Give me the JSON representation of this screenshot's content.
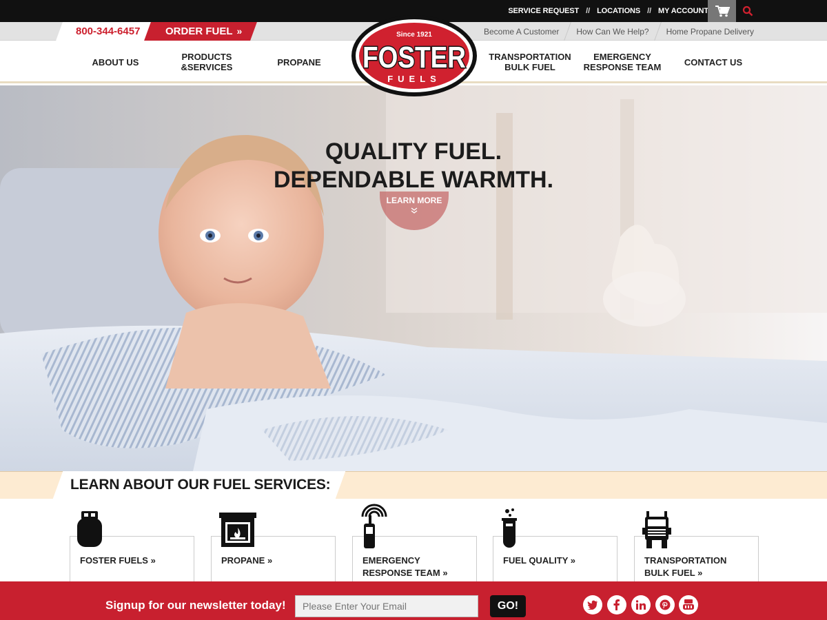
{
  "utility": {
    "links": [
      "SERVICE REQUEST",
      "LOCATIONS",
      "MY ACCOUNT"
    ],
    "separator": "//",
    "cart_icon": "cart-icon",
    "search_icon": "search-icon"
  },
  "secondary": {
    "phone": "800-344-6457",
    "order_fuel": "ORDER FUEL",
    "links": [
      "Become A Customer",
      "How Can We Help?",
      "Home Propane Delivery"
    ]
  },
  "logo": {
    "since": "Since 1921",
    "name": "FOSTER",
    "sub": "FUELS"
  },
  "nav": {
    "about": "ABOUT US",
    "products_1": "PRODUCTS",
    "products_2": "&SERVICES",
    "propane": "PROPANE",
    "transport_1": "TRANSPORTATION",
    "transport_2": "BULK FUEL",
    "emergency_1": "EMERGENCY",
    "emergency_2": "RESPONSE TEAM",
    "contact": "CONTACT US"
  },
  "hero": {
    "line1": "QUALITY FUEL.",
    "line2": "DEPENDABLE WARMTH.",
    "cta": "LEARN MORE"
  },
  "services": {
    "heading": "LEARN ABOUT OUR FUEL SERVICES:",
    "cards": [
      {
        "line1": "FOSTER FUELS",
        "line2": "",
        "icon": "propane-tank-icon"
      },
      {
        "line1": "PROPANE",
        "line2": "",
        "icon": "fireplace-icon"
      },
      {
        "line1": "EMERGENCY",
        "line2": "RESPONSE TEAM",
        "icon": "radio-icon"
      },
      {
        "line1": "FUEL QUALITY",
        "line2": "",
        "icon": "test-tube-icon"
      },
      {
        "line1": "TRANSPORTATION",
        "line2": "BULK FUEL",
        "icon": "truck-icon"
      }
    ]
  },
  "newsletter": {
    "text": "Signup for our newsletter today!",
    "placeholder": "Please Enter Your Email",
    "button": "GO!",
    "social": [
      "twitter-icon",
      "facebook-icon",
      "linkedin-icon",
      "pinterest-icon",
      "youtube-icon"
    ]
  },
  "colors": {
    "brand_red": "#c8202f",
    "dark": "#111111",
    "cream": "#fdebd2"
  }
}
